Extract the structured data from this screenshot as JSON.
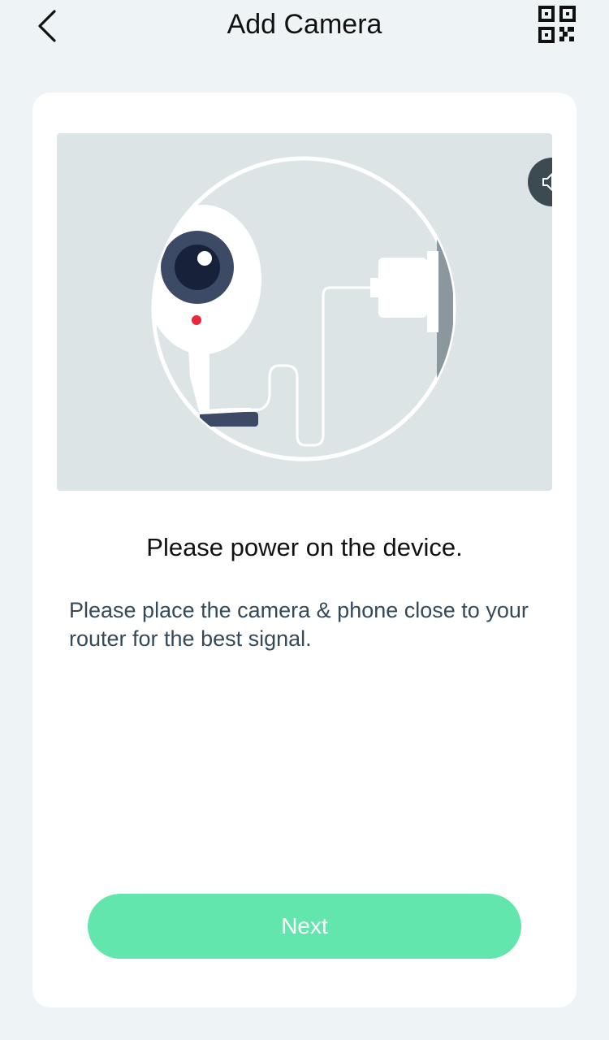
{
  "nav": {
    "title": "Add Camera",
    "back_icon": "chevron-left-icon",
    "qr_icon": "qr-code-icon"
  },
  "illustration": {
    "sound_icon": "speaker-icon",
    "indicator_color": "#e8283c"
  },
  "content": {
    "heading": "Please power on the device.",
    "description": "Please place the camera & phone close to your router for the best signal."
  },
  "actions": {
    "next_label": "Next",
    "next_color": "#63e6ae"
  }
}
